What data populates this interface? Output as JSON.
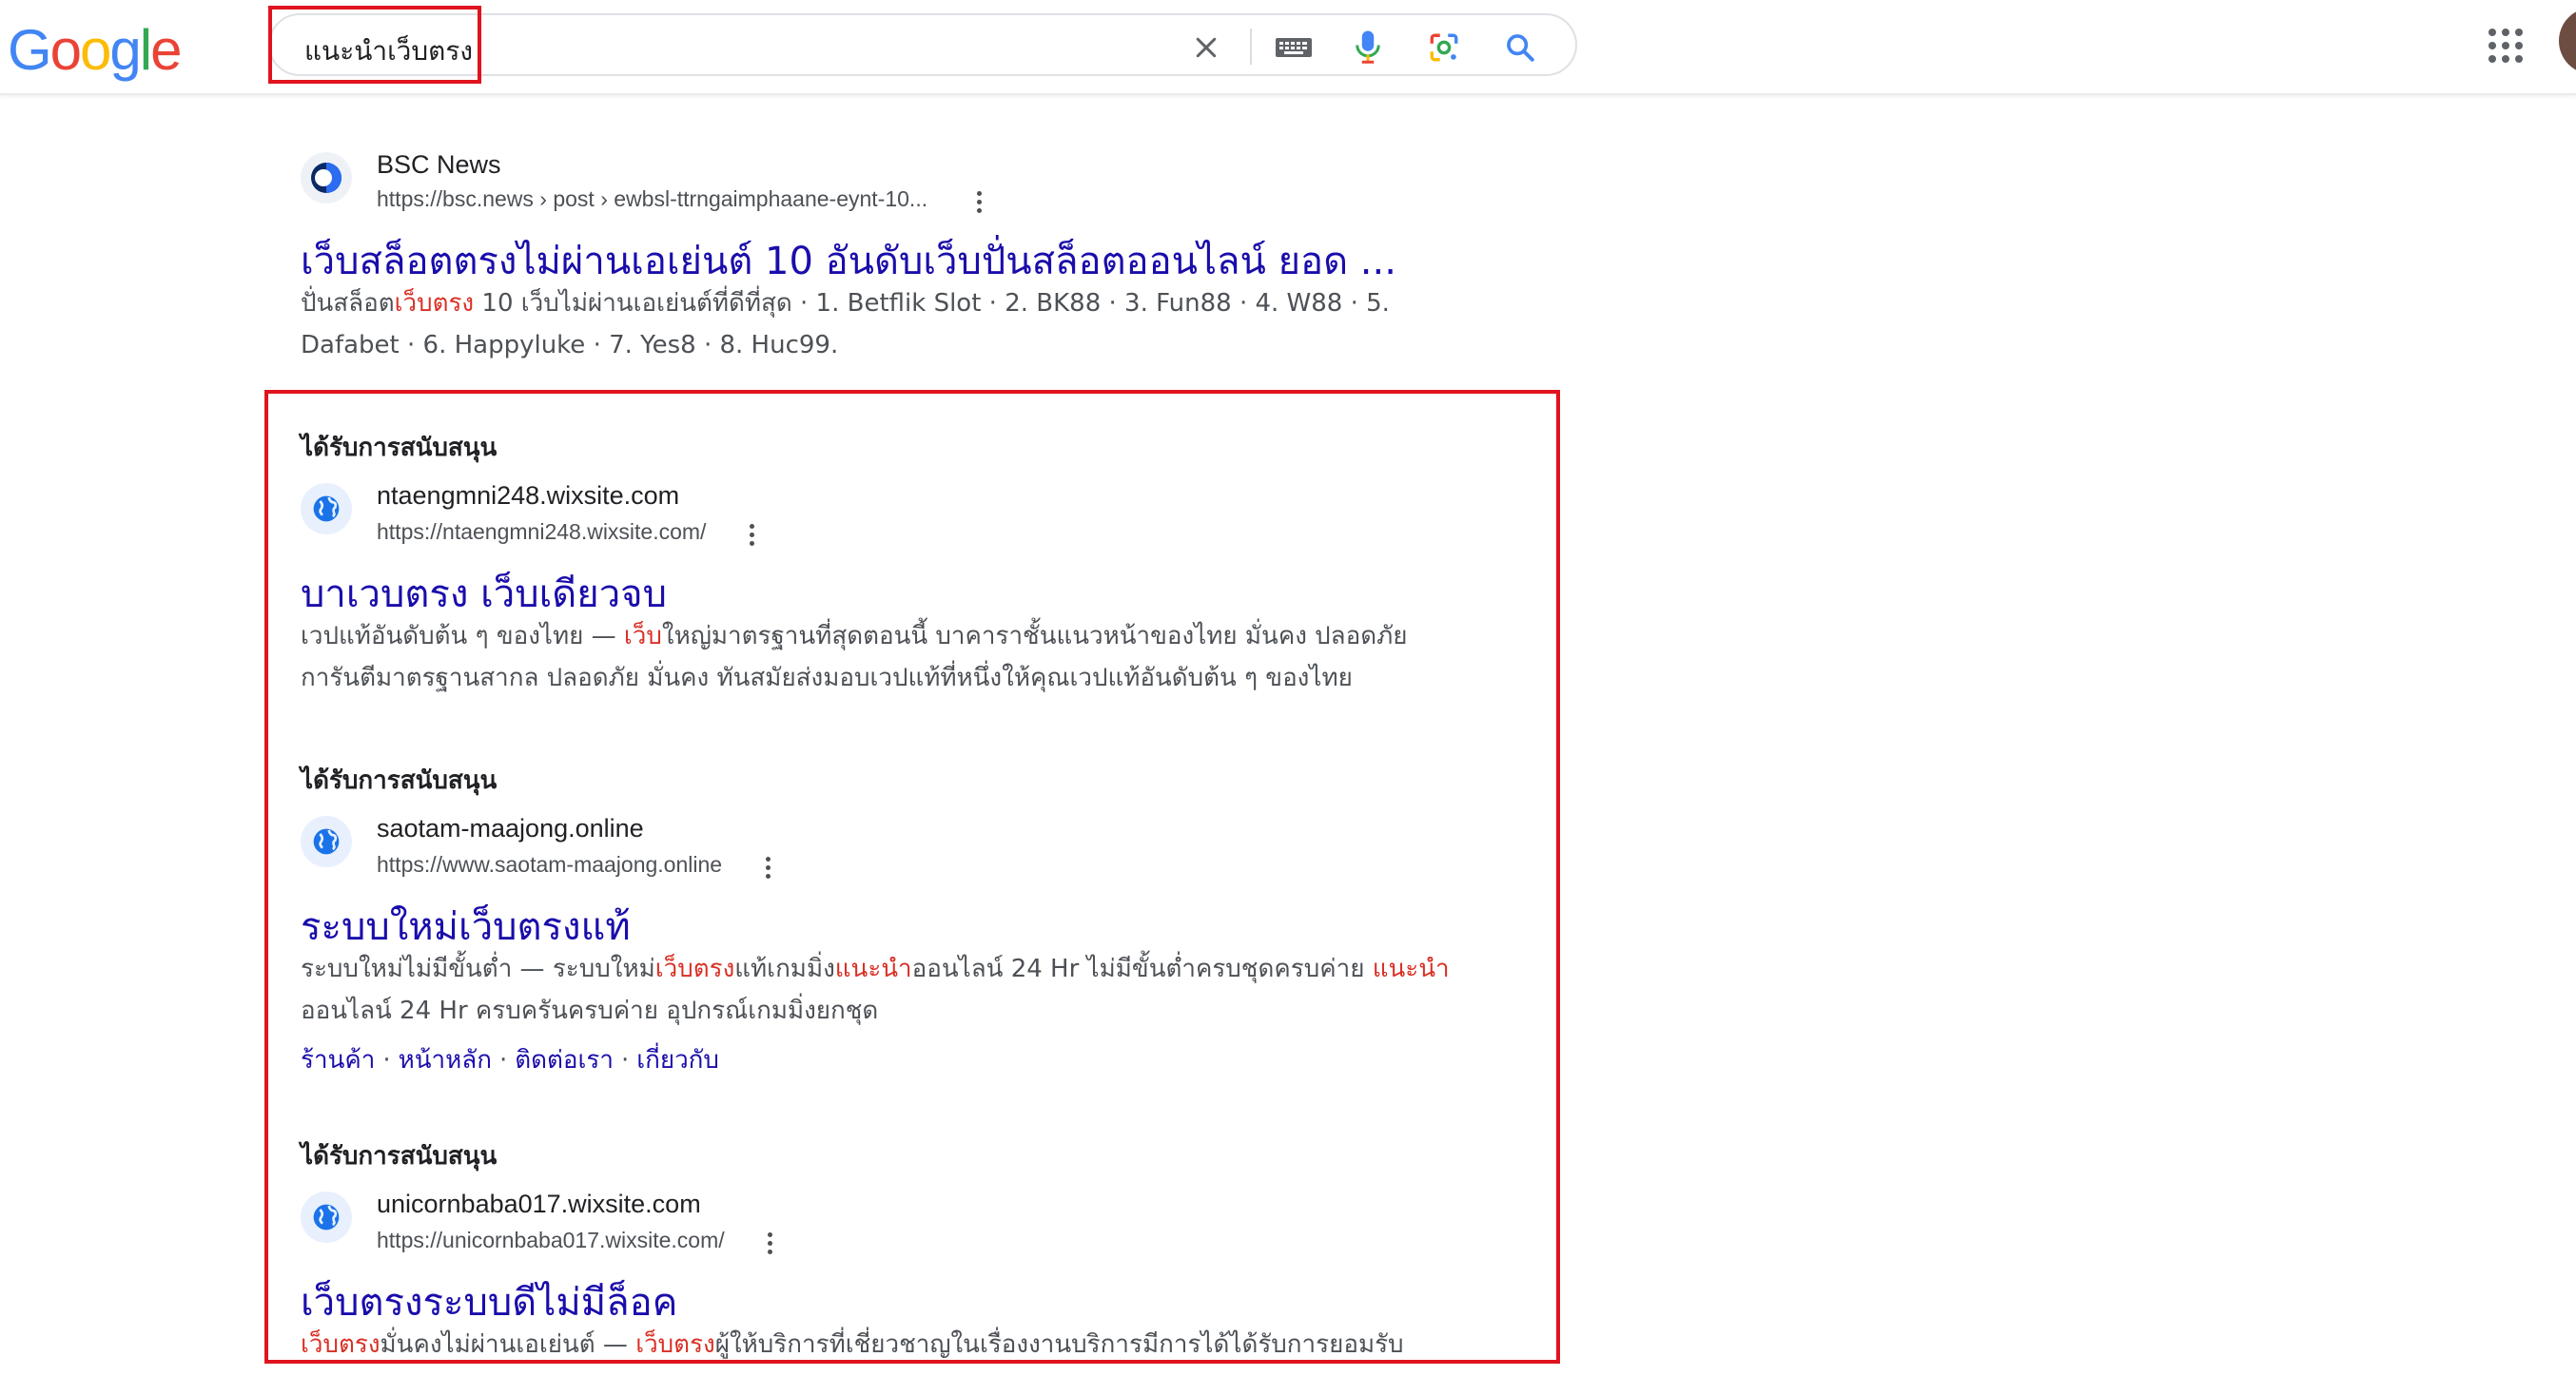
{
  "header": {
    "logo_letters": [
      {
        "ch": "G",
        "color": "#4285F4"
      },
      {
        "ch": "o",
        "color": "#EA4335"
      },
      {
        "ch": "o",
        "color": "#FBBC05"
      },
      {
        "ch": "g",
        "color": "#4285F4"
      },
      {
        "ch": "l",
        "color": "#34A853"
      },
      {
        "ch": "e",
        "color": "#EA4335"
      }
    ],
    "query": "แนะนำเว็บตรง"
  },
  "organic": {
    "site_name": "BSC News",
    "url": "https://bsc.news › post › ewbsl-ttrngaimphaane-eynt-10...",
    "title": "เว็บสล็อตตรงไม่ผ่านเอเย่นต์ 10 อันดับเว็บปั่นสล็อตออนไลน์ ยอด ...",
    "snippet_line1_a": "ปั่นสล็อต",
    "snippet_line1_em": "เว็บตรง",
    "snippet_line1_b": " 10 เว็บไม่ผ่านเอเย่นต์ที่ดีที่สุด · 1. Betflik Slot · 2. BK88 · 3. Fun88 · 4. W88 · 5.",
    "snippet_line2": "Dafabet · 6. Happyluke · 7. Yes8 · 8. Huc99."
  },
  "ads": [
    {
      "sponsored_label": "ได้รับการสนับสนุน",
      "site_name": "ntaengmni248.wixsite.com",
      "url": "https://ntaengmni248.wixsite.com/",
      "title": "บาเวบตรง เว็บเดียวจบ",
      "line1_a": "เวปแท้อันดับต้น ๆ ของไทย — ",
      "line1_em": "เว็บ",
      "line1_b": "ใหญ่มาตรฐานที่สุดตอนนี้ บาคาราชั้นแนวหน้าของไทย มั่นคง ปลอดภัย",
      "line2": "การันตีมาตรฐานสากล ปลอดภัย มั่นคง ทันสมัยส่งมอบเวปแท้ที่หนึ่งให้คุณเวปแท้อันดับต้น ๆ ของไทย"
    },
    {
      "sponsored_label": "ได้รับการสนับสนุน",
      "site_name": "saotam-maajong.online",
      "url": "https://www.saotam-maajong.online",
      "title": "ระบบใหม่เว็บตรงแท้",
      "line1_a": "ระบบใหม่ไม่มีขั้นต่ำ — ระบบใหม่",
      "line1_em": "เว็บตรง",
      "line1_b": "แท้เกมมิ่ง",
      "line1_em2": "แนะนำ",
      "line1_c": "ออนไลน์ 24 Hr ไม่มีขั้นต่ำครบชุดครบค่าย ",
      "line1_em3": "แนะนำ",
      "line2": "ออนไลน์ 24 Hr ครบครันครบค่าย อุปกรณ์เกมมิ่งยกชุด",
      "sitelinks": [
        "ร้านค้า",
        "หน้าหลัก",
        "ติดต่อเรา",
        "เกี่ยวกับ"
      ]
    },
    {
      "sponsored_label": "ได้รับการสนับสนุน",
      "site_name": "unicornbaba017.wixsite.com",
      "url": "https://unicornbaba017.wixsite.com/",
      "title": "เว็บตรงระบบดีไม่มีล็อค",
      "line1_em": "เว็บตรง",
      "line1_a": "มั่นคงไม่ผ่านเอเย่นต์ — ",
      "line1_em2": "เว็บตรง",
      "line1_b": "ผู้ให้บริการที่เชี่ยวชาญในเรื่องงานบริการมีการได้ได้รับการยอมรับ"
    }
  ]
}
